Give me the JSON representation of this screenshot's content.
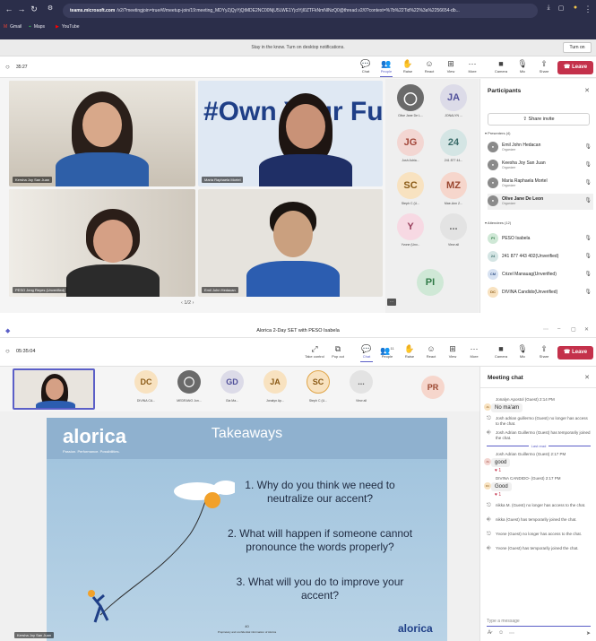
{
  "browser": {
    "url_domain": "teams.microsoft.com",
    "url_path": "/v2/?meetingjoin=true#/l/meetup-join/19:meeting_MDYyZjQyYjQtMDE2NC00NjU5LWE1YjctYjI0ZTFkNmNlNzQ0@thread.v2/0?context=%7b%22Tid%22%3a%2256654-db...",
    "bookmarks": [
      "Gmail",
      "Maps",
      "YouTube"
    ]
  },
  "notification": {
    "message": "Stay in the know. Turn on desktop notifications.",
    "button": "Turn on"
  },
  "meeting1": {
    "time": "35:27",
    "toolbar": [
      "Chat",
      "People",
      "Raise",
      "React",
      "View",
      "More",
      "Camera",
      "Mic",
      "Share"
    ],
    "leave": "Leave",
    "videos": [
      "Kersha Joy San Juan",
      "Maria Raphaela Mortel",
      "PESO Jeng Reyes (Unverified)",
      "Emil John Hedacan"
    ],
    "slide_text": "#Own Your Fu",
    "pager": "1/2",
    "tiles": [
      {
        "initials": "",
        "label": "Olive Jane De L..."
      },
      {
        "initials": "JA",
        "label": "JONALYN ..."
      },
      {
        "initials": "JG",
        "label": "Josh Adria..."
      },
      {
        "initials": "24",
        "label": "241 877 44..."
      },
      {
        "initials": "SC",
        "label": "Steph C (U..."
      },
      {
        "initials": "MZ",
        "label": "Mae-Ann Z..."
      },
      {
        "initials": "Y",
        "label": "Yvone (Unv..."
      },
      {
        "initials": "...",
        "label": "View all"
      }
    ],
    "self_tile": "PI"
  },
  "participants": {
    "title": "Participants",
    "share": "Share invite",
    "presenters_header": "Presenters (4)",
    "presenters": [
      {
        "name": "Emil John Hedacan",
        "role": "Organizer"
      },
      {
        "name": "Keesha Joy San Juan",
        "role": "Organizer"
      },
      {
        "name": "Maria Raphaela Mortel",
        "role": "Organizer"
      },
      {
        "name": "Olive Jane De Leon",
        "role": "Organizer"
      }
    ],
    "attendees_header": "Attendees (12)",
    "attendees": [
      {
        "initials": "PI",
        "name": "PESO Isabela"
      },
      {
        "initials": "24",
        "name": "241 877 443 402(Unverified)"
      },
      {
        "initials": "CM",
        "name": "Crizel Manauag(Unverified)"
      },
      {
        "initials": "DC",
        "name": "DIVINA Candido(Unverified)"
      }
    ]
  },
  "meeting2": {
    "title": "Alorica 2-Day SET with PESO Isabela",
    "time": "05:35:04",
    "toolbar": [
      "Take control",
      "Pop out",
      "Chat",
      "People",
      "Raise",
      "React",
      "View",
      "More",
      "Camera",
      "Mic",
      "Share"
    ],
    "people_count": "11",
    "leave": "Leave",
    "strip": [
      {
        "initials": "DC",
        "label": "DIVINA CA..."
      },
      {
        "initials": "",
        "label": "MEDRANO Jon..."
      },
      {
        "initials": "GD",
        "label": "Gia Ma..."
      },
      {
        "initials": "JA",
        "label": "Jonalyn Ap..."
      },
      {
        "initials": "SC",
        "label": "Steph C (U..."
      },
      {
        "initials": "...",
        "label": "View all"
      }
    ],
    "pr_tile": "PR",
    "self_name": "Kersha Joy San Juan"
  },
  "slide": {
    "brand": "alorica",
    "tagline": "Passion. Performance. Possibilities.",
    "title": "Takeaways",
    "q1": [
      "1. Why do you think we need to",
      "neutralize our accent?"
    ],
    "q2": [
      "2. What will happen if someone cannot",
      "pronounce the words properly?"
    ],
    "q3": [
      "3. What will you do to improve your",
      "accent?"
    ],
    "page": "40",
    "footer": "Proprietary and confidential information of Alorica"
  },
  "chat": {
    "title": "Meeting chat",
    "m1_head": "Jonalyn Apostol (Guest)  2:14 PM",
    "m1": "No ma'am",
    "s1": "Josh adrian guillermo (Guest) no longer has access to the chat.",
    "s2": "Josh Adrian Guillermo (Guest) has temporarily joined the chat.",
    "last_read": "Last read",
    "m2_head": "Josh Adrian Guillermo (Guest)  2:17 PM",
    "m2": "good",
    "m3_head": "DIVINA CANDIDO- (Guest)  2:17 PM",
    "m3": "Good",
    "s3": "nikka M. (Guest) no longer has access to the chat.",
    "s4": "nikka (Guest) has temporarily joined the chat.",
    "s5": "Yvone (Guest) no longer has access to the chat.",
    "s6": "Yvone (Guest) has temporarily joined the chat.",
    "input_placeholder": "Type a message"
  },
  "colors": {
    "teams_purple": "#5b5fc7",
    "leave_red": "#c4314b",
    "slide_bg": "#8cb5d4",
    "alorica_blue": "#1f3f87"
  }
}
